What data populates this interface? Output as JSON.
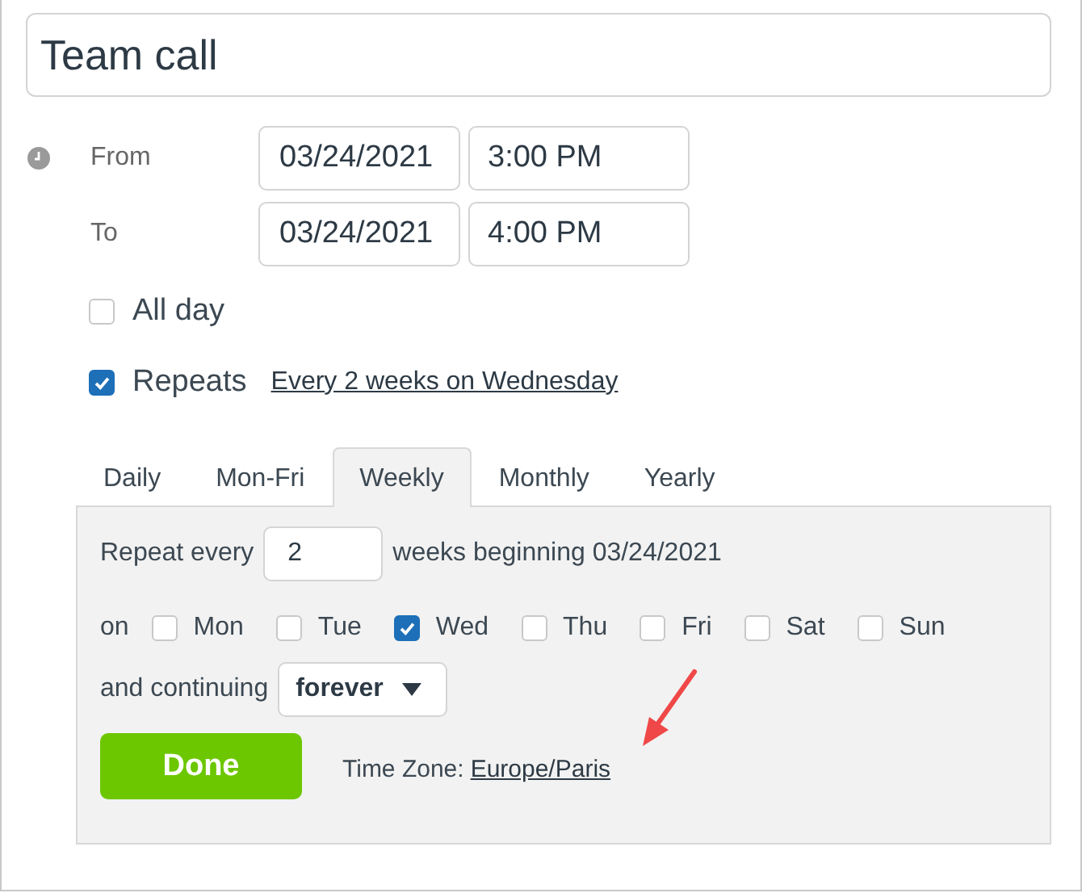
{
  "title_field": {
    "value": "Team call"
  },
  "time_rows": [
    {
      "label": "From",
      "date": "03/24/2021",
      "time": "3:00 PM"
    },
    {
      "label": "To",
      "date": "03/24/2021",
      "time": "4:00 PM"
    }
  ],
  "all_day": {
    "label": "All day",
    "checked": false
  },
  "repeats": {
    "label": "Repeats",
    "checked": true,
    "summary": "Every 2 weeks on Wednesday"
  },
  "tabs": [
    {
      "label": "Daily",
      "selected": false
    },
    {
      "label": "Mon-Fri",
      "selected": false
    },
    {
      "label": "Weekly",
      "selected": true
    },
    {
      "label": "Monthly",
      "selected": false
    },
    {
      "label": "Yearly",
      "selected": false
    }
  ],
  "weekly": {
    "repeat_label": "Repeat every",
    "interval": "2",
    "interval_suffix": "weeks beginning 03/24/2021",
    "on_label": "on",
    "days": [
      {
        "label": "Mon",
        "checked": false
      },
      {
        "label": "Tue",
        "checked": false
      },
      {
        "label": "Wed",
        "checked": true
      },
      {
        "label": "Thu",
        "checked": false
      },
      {
        "label": "Fri",
        "checked": false
      },
      {
        "label": "Sat",
        "checked": false
      },
      {
        "label": "Sun",
        "checked": false
      }
    ],
    "continuing_label": "and continuing",
    "continuing_value": "forever",
    "done": "Done",
    "timezone_label": "Time Zone:",
    "timezone": "Europe/Paris"
  }
}
